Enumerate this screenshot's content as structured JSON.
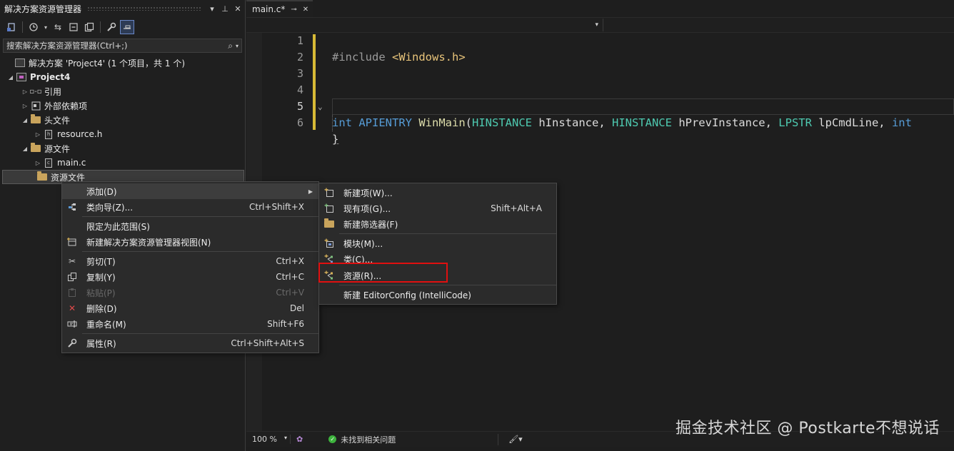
{
  "solution_explorer": {
    "title": "解决方案资源管理器",
    "title_buttons": [
      "▾",
      "⊥",
      "✕"
    ],
    "search_placeholder": "搜索解决方案资源管理器(Ctrl+;)",
    "tree": {
      "solution": "解决方案 'Project4' (1 个项目，共 1 个)",
      "project": "Project4",
      "references": "引用",
      "external_deps": "外部依赖项",
      "header_files": "头文件",
      "resource_h": "resource.h",
      "source_files": "源文件",
      "main_c": "main.c",
      "resource_files": "资源文件"
    }
  },
  "editor": {
    "tab": {
      "label": "main.c*",
      "pin": "⊸",
      "close": "✕"
    },
    "line_numbers": [
      "1",
      "2",
      "3",
      "4",
      "5",
      "6"
    ],
    "code": {
      "l1_pre": "#include ",
      "l1_inc": "<Windows.h>",
      "l4_int": "int",
      "l4_apientry": " APIENTRY ",
      "l4_fn": "WinMain",
      "l4_p1": "(",
      "l4_t1": "HINSTANCE",
      "l4_v1": " hInstance, ",
      "l4_t2": "HINSTANCE",
      "l4_v2": " hPrevInstance, ",
      "l4_t3": "LPSTR",
      "l4_v3": " lpCmdLine, ",
      "l4_int2": "int",
      "l6": "}"
    },
    "status": {
      "zoom": "100 %",
      "zoom_arrow": "▾",
      "issues": "未找到相关问题"
    }
  },
  "context_menu": {
    "items": [
      {
        "label": "添加(D)",
        "shortcut": ""
      },
      {
        "label": "类向导(Z)...",
        "shortcut": "Ctrl+Shift+X"
      },
      {
        "label": "限定为此范围(S)",
        "shortcut": ""
      },
      {
        "label": "新建解决方案资源管理器视图(N)",
        "shortcut": ""
      },
      {
        "label": "剪切(T)",
        "shortcut": "Ctrl+X"
      },
      {
        "label": "复制(Y)",
        "shortcut": "Ctrl+C"
      },
      {
        "label": "粘贴(P)",
        "shortcut": "Ctrl+V"
      },
      {
        "label": "删除(D)",
        "shortcut": "Del"
      },
      {
        "label": "重命名(M)",
        "shortcut": "Shift+F6"
      },
      {
        "label": "属性(R)",
        "shortcut": "Ctrl+Shift+Alt+S"
      }
    ]
  },
  "add_submenu": {
    "items": [
      {
        "label": "新建项(W)...",
        "shortcut": ""
      },
      {
        "label": "现有项(G)...",
        "shortcut": "Shift+Alt+A"
      },
      {
        "label": "新建筛选器(F)",
        "shortcut": ""
      },
      {
        "label": "模块(M)...",
        "shortcut": ""
      },
      {
        "label": "类(C)...",
        "shortcut": ""
      },
      {
        "label": "资源(R)...",
        "shortcut": ""
      },
      {
        "label": "新建 EditorConfig (IntelliCode)",
        "shortcut": ""
      }
    ]
  },
  "watermark": "掘金技术社区 @ Postkarte不想说话",
  "colors": {
    "highlight": "#e01010",
    "keyword": "#569cd6",
    "type": "#4ec9b0",
    "function": "#dcdcaa",
    "change_bar": "#d7ba36"
  }
}
